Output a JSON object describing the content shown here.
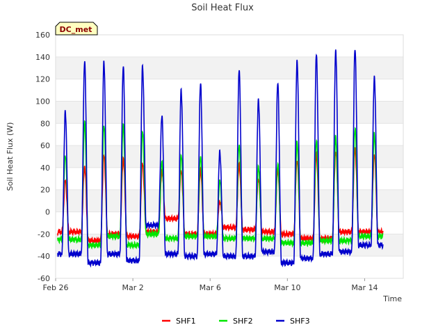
{
  "chart_data": {
    "type": "line",
    "title": "Soil Heat Flux",
    "xlabel": "Time",
    "ylabel": "Soil Heat Flux (W)",
    "site_badge": "DC_met",
    "ylim": [
      -60,
      160
    ],
    "yticks": [
      -60,
      -40,
      -20,
      0,
      20,
      40,
      60,
      80,
      100,
      120,
      140,
      160
    ],
    "xlim_days": [
      0,
      18
    ],
    "xticks": [
      {
        "day": 0,
        "label": "Feb 26"
      },
      {
        "day": 4,
        "label": "Mar 2"
      },
      {
        "day": 8,
        "label": "Mar 6"
      },
      {
        "day": 12,
        "label": "Mar 10"
      },
      {
        "day": 16,
        "label": "Mar 14"
      }
    ],
    "grid": true,
    "legend_position": "bottom-center",
    "day_peak_fraction": 0.5,
    "series": [
      {
        "name": "SHF1",
        "color": "#ff0000",
        "day_baselines": [
          -18,
          -26,
          -20,
          -22,
          -18,
          -6,
          -20,
          -20,
          -14,
          -16,
          -18,
          -20,
          -24,
          -24,
          -18,
          -18
        ],
        "day_peaks": [
          28,
          41,
          51,
          48,
          44,
          37,
          37,
          38,
          10,
          42,
          30,
          38,
          47,
          52,
          55,
          57,
          52
        ]
      },
      {
        "name": "SHF2",
        "color": "#00e600",
        "day_baselines": [
          -25,
          -30,
          -22,
          -30,
          -20,
          -24,
          -22,
          -22,
          -24,
          -24,
          -24,
          -28,
          -28,
          -26,
          -26,
          -22
        ],
        "day_peaks": [
          52,
          80,
          79,
          78,
          73,
          45,
          51,
          50,
          28,
          61,
          40,
          44,
          62,
          65,
          67,
          76,
          70
        ]
      },
      {
        "name": "SHF3",
        "color": "#0000cc",
        "day_baselines": [
          -38,
          -46,
          -38,
          -44,
          -12,
          -38,
          -40,
          -38,
          -40,
          -40,
          -36,
          -46,
          -42,
          -38,
          -36,
          -30
        ],
        "day_peaks": [
          90,
          137,
          135,
          132,
          131,
          87,
          110,
          116,
          55,
          128,
          102,
          116,
          137,
          142,
          146,
          147,
          122
        ]
      }
    ]
  }
}
